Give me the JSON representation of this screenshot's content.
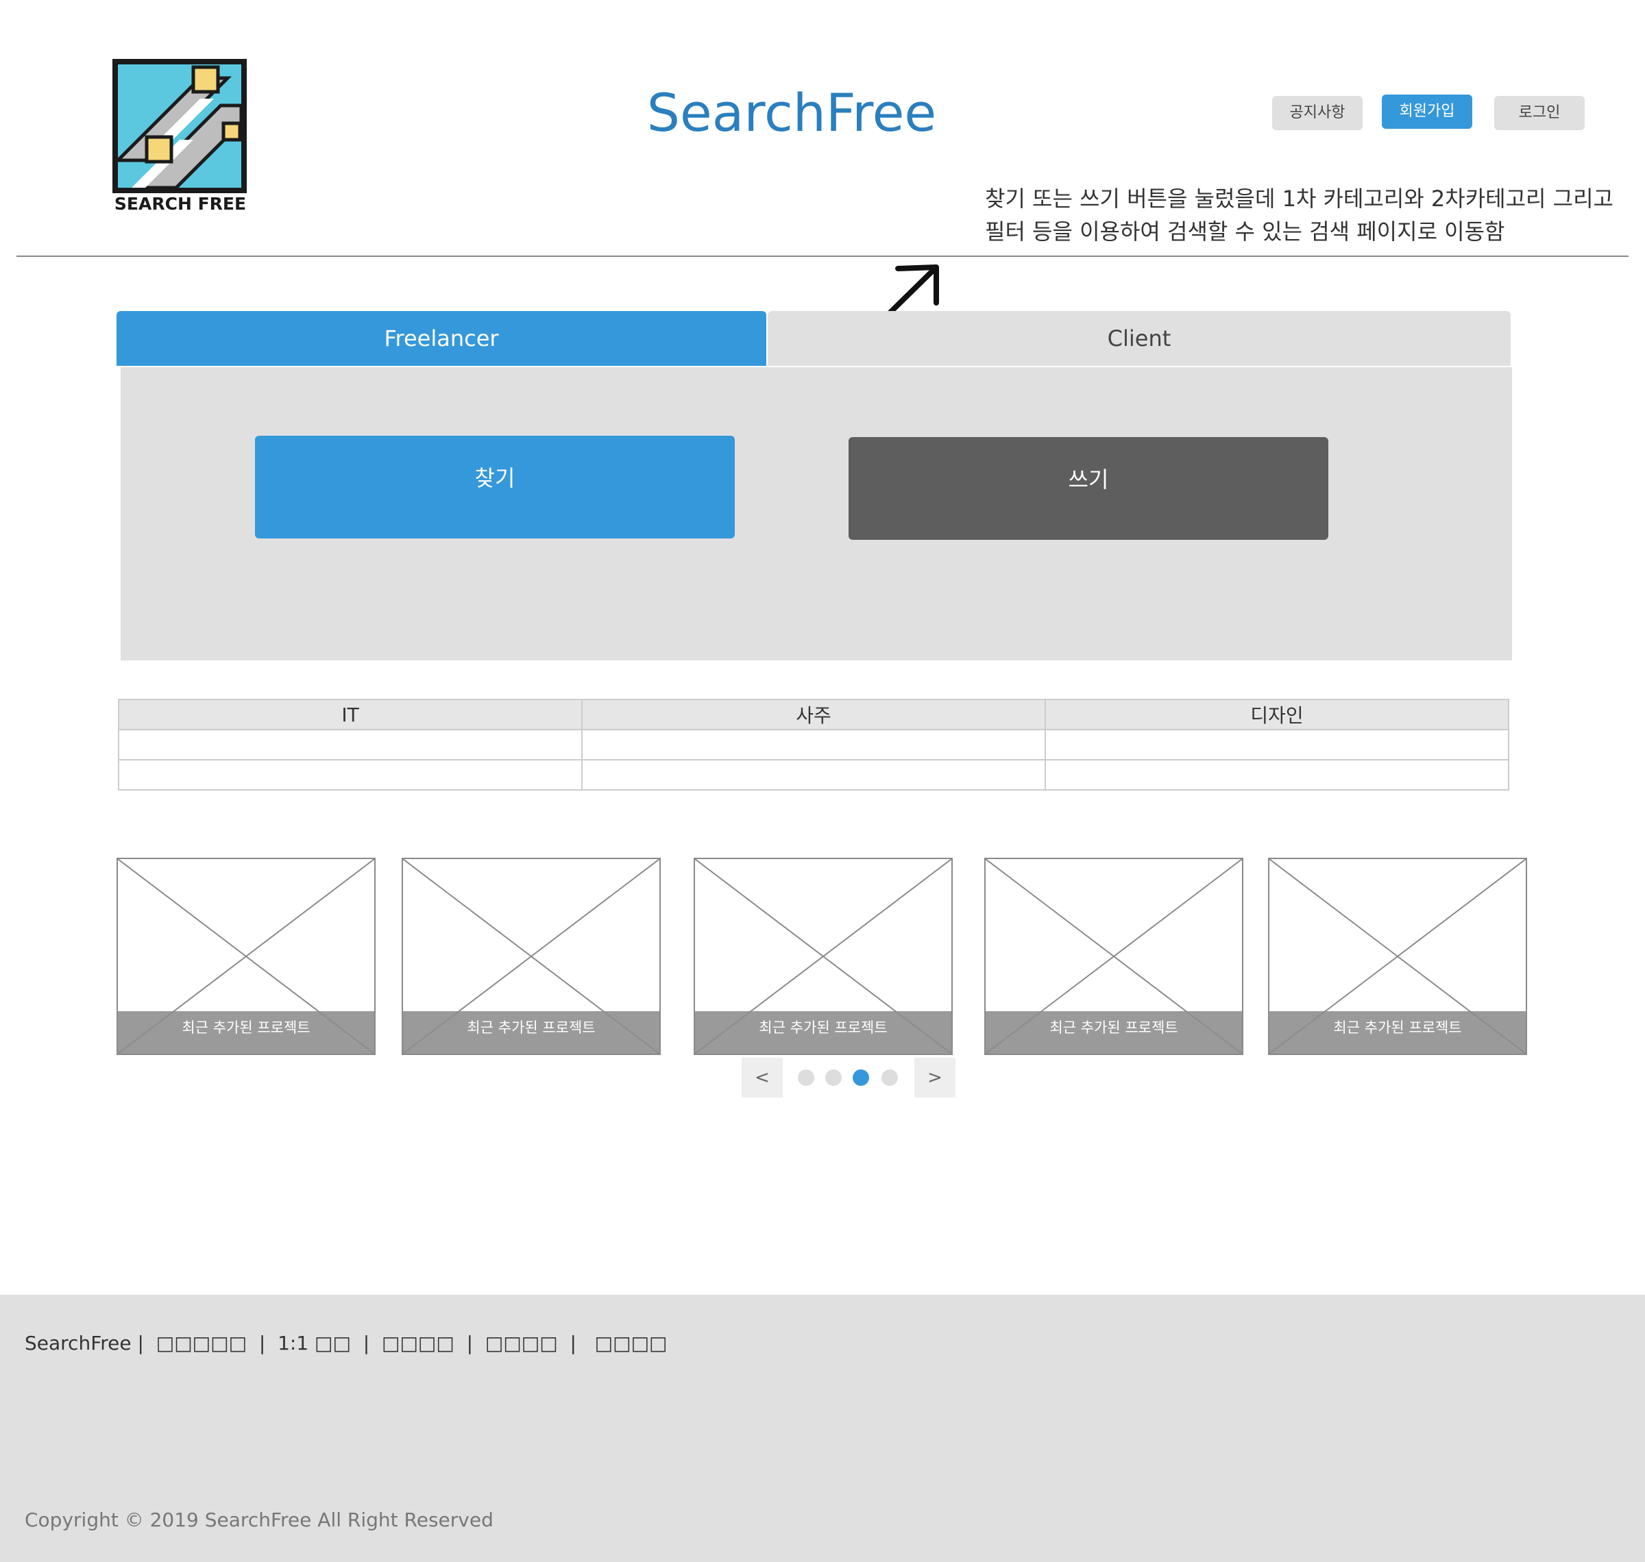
{
  "header": {
    "logo_text": "SEARCH FREE",
    "site_title": "SearchFree",
    "buttons": {
      "notice": "공지사항",
      "signup": "회원가입",
      "login": "로그인"
    },
    "annotation": "찾기 또는 쓰기 버튼을 눌렀을데 1차 카테고리와 2차카테고리 그리고 필터 등을 이용하여 검색할 수 있는 검색 페이지로 이동함"
  },
  "tabs": {
    "freelancer": "Freelancer",
    "client": "Client"
  },
  "actions": {
    "find": "찾기",
    "write": "쓰기"
  },
  "categories": {
    "headers": [
      "IT",
      "사주",
      "디자인"
    ],
    "rows": [
      [
        "",
        "",
        ""
      ],
      [
        "",
        "",
        ""
      ]
    ]
  },
  "cards": [
    {
      "caption": "최근 추가된 프로젝트"
    },
    {
      "caption": "최근 추가된 프로젝트"
    },
    {
      "caption": "최근 추가된 프로젝트"
    },
    {
      "caption": "최근 추가된 프로젝트"
    },
    {
      "caption": "최근 추가된 프로젝트"
    }
  ],
  "pager": {
    "prev": "<",
    "next": ">",
    "total_pages": 4,
    "current_page": 3
  },
  "footer": {
    "brand": "SearchFree",
    "links": [
      "□□□□□",
      "1:1 □□",
      "□□□□",
      "□□□□",
      "□□□□"
    ],
    "copyright": "Copyright © 2019 SearchFree All Right Reserved"
  },
  "colors": {
    "accent": "#3598db",
    "title": "#2a7fbf",
    "dark_button": "#5e5e5e",
    "panel": "#e0e0e0"
  }
}
